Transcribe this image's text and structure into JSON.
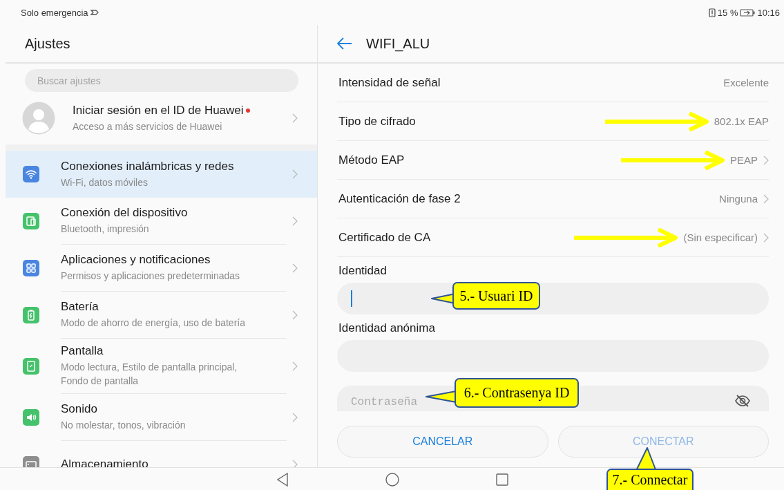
{
  "status_bar": {
    "network_text": "Solo emergencia",
    "battery_percent": "15 %",
    "time": "10:16"
  },
  "sidebar": {
    "title": "Ajustes",
    "search": {
      "placeholder": "Buscar ajustes"
    },
    "account": {
      "title": "Iniciar sesión en el ID de Huawei",
      "subtitle": "Acceso a más servicios de Huawei",
      "notification": true
    },
    "items": [
      {
        "kind": "wifi",
        "color": "#4a86e0",
        "title": "Conexiones inalámbricas y redes",
        "subtitle": "Wi-Fi, datos móviles",
        "selected": true
      },
      {
        "kind": "devices",
        "color": "#45c26b",
        "title": "Conexión del dispositivo",
        "subtitle": "Bluetooth, impresión",
        "selected": false
      },
      {
        "kind": "apps",
        "color": "#4a86e0",
        "title": "Aplicaciones y notificaciones",
        "subtitle": "Permisos y aplicaciones predeterminadas",
        "selected": false
      },
      {
        "kind": "battery",
        "color": "#45c26b",
        "title": "Batería",
        "subtitle": "Modo de ahorro de energía, uso de batería",
        "selected": false
      },
      {
        "kind": "display",
        "color": "#45c26b",
        "title": "Pantalla",
        "subtitle": "Modo lectura, Estilo de pantalla principal, Fondo de pantalla",
        "selected": false
      },
      {
        "kind": "sound",
        "color": "#45c26b",
        "title": "Sonido",
        "subtitle": "No molestar, tonos, vibración",
        "selected": false
      },
      {
        "kind": "storage",
        "color": "#8e8e8e",
        "title": "Almacenamiento",
        "selected": false
      }
    ]
  },
  "detail": {
    "title": "WIFI_ALU",
    "rows": [
      {
        "label": "Intensidad de señal",
        "value": "Excelente",
        "chevron": false,
        "annotated": false
      },
      {
        "label": "Tipo de cifrado",
        "value": "802.1x EAP",
        "chevron": false,
        "annotated": true
      },
      {
        "label": "Método EAP",
        "value": "PEAP",
        "chevron": true,
        "annotated": true
      },
      {
        "label": "Autenticación de fase 2",
        "value": "Ninguna",
        "chevron": true,
        "annotated": false
      },
      {
        "label": "Certificado de CA",
        "value": "(Sin especificar)",
        "chevron": true,
        "annotated": true
      }
    ],
    "fields": [
      {
        "label": "Identidad",
        "focused": true
      },
      {
        "label": "Identidad anónima",
        "focused": false
      }
    ],
    "password": {
      "placeholder": "Contraseña"
    },
    "buttons": [
      {
        "label": "CANCELAR",
        "disabled": false
      },
      {
        "label": "CONECTAR",
        "disabled": true
      }
    ]
  },
  "callouts": [
    {
      "text": "5.- Usuari ID"
    },
    {
      "text": "6.- Contrasenya ID"
    },
    {
      "text": "7.- Connectar"
    }
  ]
}
